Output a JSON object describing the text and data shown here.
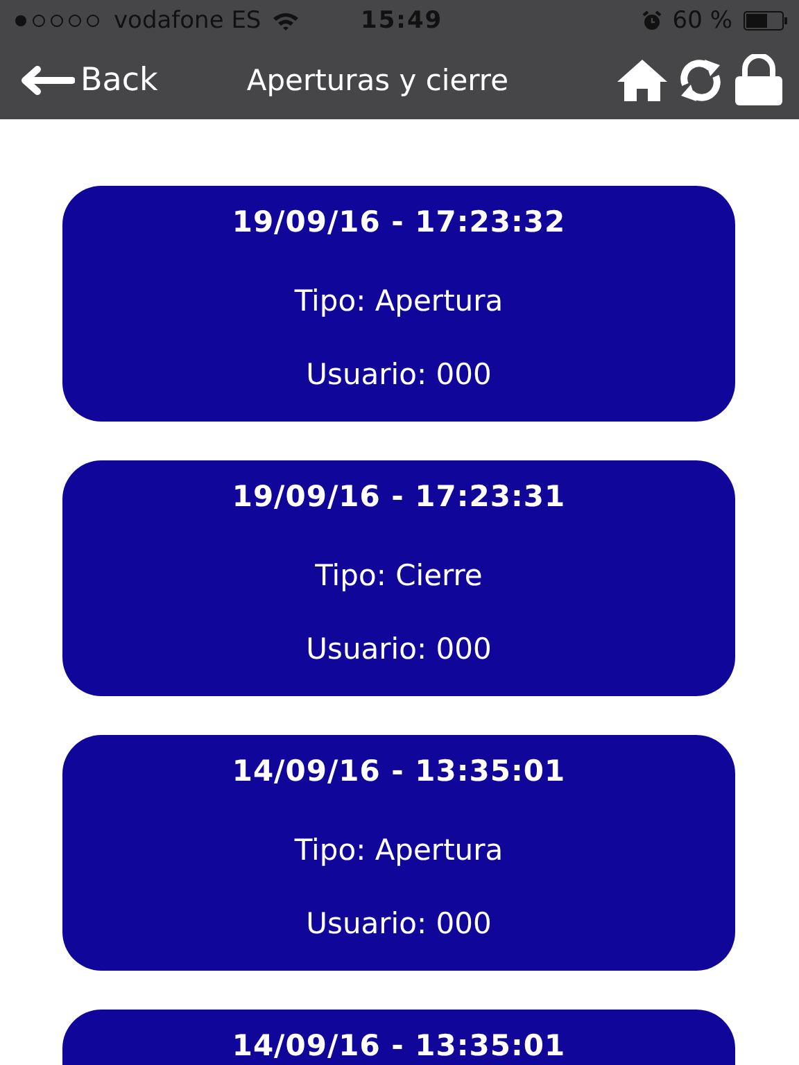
{
  "status_bar": {
    "carrier": "vodafone ES",
    "time": "15:49",
    "battery": "60 %"
  },
  "nav_bar": {
    "back": "Back",
    "title": "Aperturas y cierre"
  },
  "events": [
    {
      "datetime": "19/09/16 - 17:23:32",
      "type": "Tipo: Apertura",
      "user": "Usuario: 000"
    },
    {
      "datetime": "19/09/16 - 17:23:31",
      "type": "Tipo: Cierre",
      "user": "Usuario: 000"
    },
    {
      "datetime": "14/09/16 - 13:35:01",
      "type": "Tipo: Apertura",
      "user": "Usuario: 000"
    },
    {
      "datetime": "14/09/16 - 13:35:01"
    }
  ]
}
